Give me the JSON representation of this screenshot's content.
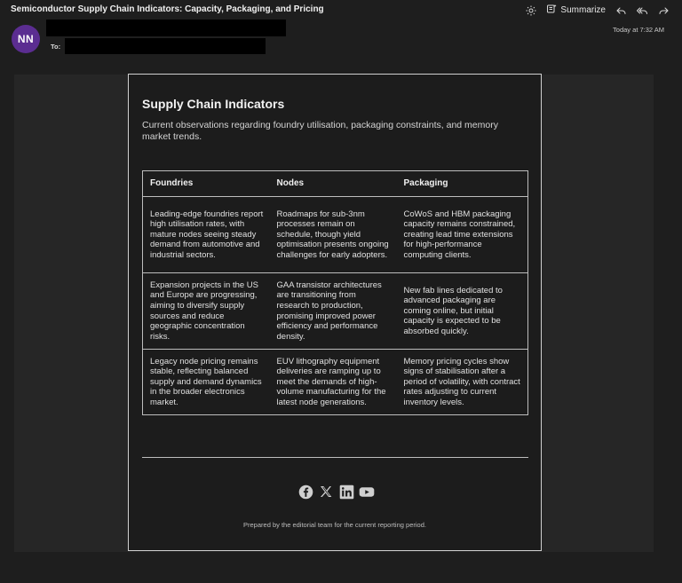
{
  "email": {
    "subject": "Semiconductor Supply Chain Indicators: Capacity, Packaging, and Pricing",
    "avatar_initials": "NN",
    "to_label": "To:",
    "timestamp": "Today at 7:32 AM"
  },
  "toolbar": {
    "summarize_label": "Summarize",
    "icons": [
      "brightness-icon",
      "summarize-icon",
      "reply-icon",
      "reply-all-icon",
      "forward-icon"
    ]
  },
  "card": {
    "title": "Supply Chain Indicators",
    "intro": "Current observations regarding foundry utilisation, packaging constraints, and memory market trends.",
    "table": {
      "headers": [
        "Foundries",
        "Nodes",
        "Packaging"
      ],
      "rows": [
        [
          "Leading-edge foundries report high utilisation rates, with mature nodes seeing steady demand from automotive and industrial sectors.",
          "Roadmaps for sub-3nm processes remain on schedule, though yield optimisation presents ongoing challenges for early adopters.",
          "CoWoS and HBM packaging capacity remains constrained, creating lead time extensions for high-performance computing clients."
        ],
        [
          "Expansion projects in the US and Europe are progressing, aiming to diversify supply sources and reduce geographic concentration risks.",
          "GAA transistor architectures are transitioning from research to production, promising improved power efficiency and performance density.",
          "New fab lines dedicated to advanced packaging are coming online, but initial capacity is expected to be absorbed quickly."
        ],
        [
          "Legacy node pricing remains stable, reflecting balanced supply and demand dynamics in the broader electronics market.",
          "EUV lithography equipment deliveries are ramping up to meet the demands of high-volume manufacturing for the latest node generations.",
          "Memory pricing cycles show signs of stabilisation after a period of volatility, with contract rates adjusting to current inventory levels."
        ]
      ]
    },
    "socials": [
      "facebook-icon",
      "x-icon",
      "linkedin-icon",
      "youtube-icon"
    ],
    "footer": "Prepared by the editorial team for the current reporting period."
  },
  "colors": {
    "background": "#1e1e1e",
    "panel": "#262626",
    "card": "#1c1c1c",
    "avatar": "#5b2d91",
    "border": "#bdbdbd"
  }
}
